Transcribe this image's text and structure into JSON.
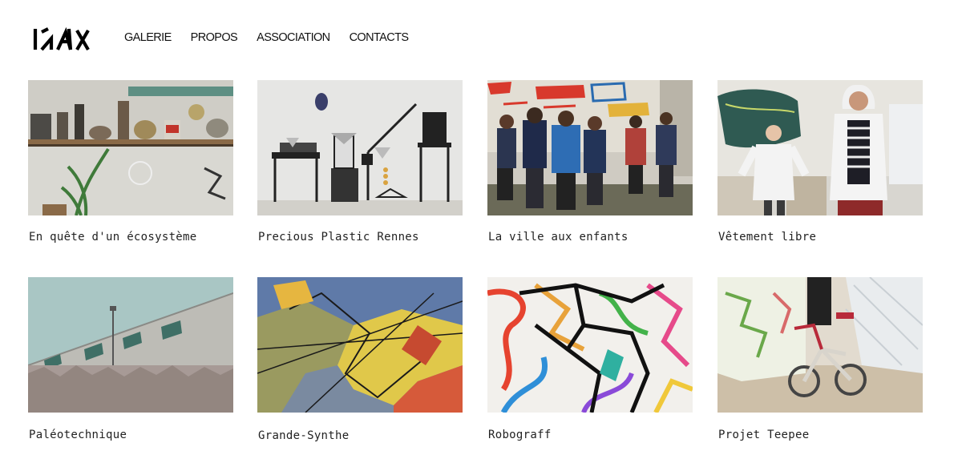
{
  "site": {
    "logo_alt": "IDLV"
  },
  "nav": {
    "items": [
      {
        "label": "GALERIE"
      },
      {
        "label": "PROPOS"
      },
      {
        "label": "ASSOCIATION"
      },
      {
        "label": "CONTACTS"
      }
    ]
  },
  "gallery": {
    "projects": [
      {
        "title": "En quête d'un écosystème",
        "image": "shelf-with-stones-and-plant-photo"
      },
      {
        "title": "Precious Plastic Rennes",
        "image": "plastic-recycling-machines-photo"
      },
      {
        "title": "La ville aux enfants",
        "image": "children-walking-by-graffiti-wall-photo"
      },
      {
        "title": "Vêtement libre",
        "image": "people-modeling-white-jackets-photo"
      },
      {
        "title": "Paléotechnique",
        "image": "concrete-building-over-dry-grass-photo"
      },
      {
        "title": "Grande-Synthe",
        "image": "world-map-mural-on-brick-photo"
      },
      {
        "title": "Robograff",
        "image": "colorful-yarn-drawing-photo"
      },
      {
        "title": "Projet Teepee",
        "image": "child-bicycle-under-net-photo"
      }
    ]
  },
  "colors": {
    "text": "#111111",
    "caption": "#222222",
    "background": "#ffffff"
  }
}
